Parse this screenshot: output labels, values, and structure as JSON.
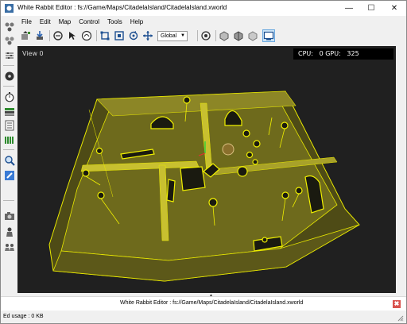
{
  "window": {
    "title": "White Rabbit Editor : fs://Game/Maps/CitadelaIsland/CitadelaIsland.xworld",
    "controls": {
      "minimize": "—",
      "maximize": "☐",
      "close": "✕"
    }
  },
  "menu": [
    "File",
    "Edit",
    "Map",
    "Control",
    "Tools",
    "Help"
  ],
  "toolbar": {
    "space_combo": "Global",
    "icons": [
      "new-object-icon",
      "import-icon",
      "paint-icon",
      "select-icon",
      "move-icon",
      "rotate-icon",
      "scale-icon",
      "snap-icon",
      "physics-icon",
      "wireframe-icon",
      "shaded-icon",
      "fullscreen-icon"
    ]
  },
  "viewport": {
    "label": "View 0",
    "stats": "CPU:   0 GPU:   325"
  },
  "bottom_panel": {
    "text": "White Rabbit Editor : fs://Game/Maps/CitadelaIsland/CitadelaIsland.xworld",
    "close": "✖"
  },
  "status": {
    "text": "Ed usage : 0 KB"
  },
  "colors": {
    "viewport_bg": "#202020",
    "wire": "#e8e800",
    "floor": "#6e6a1c",
    "floor_light": "#8c8626",
    "wall_top": "#c8c030",
    "wall_side": "#4e4b16",
    "accent_selected": "#cce4f7"
  }
}
